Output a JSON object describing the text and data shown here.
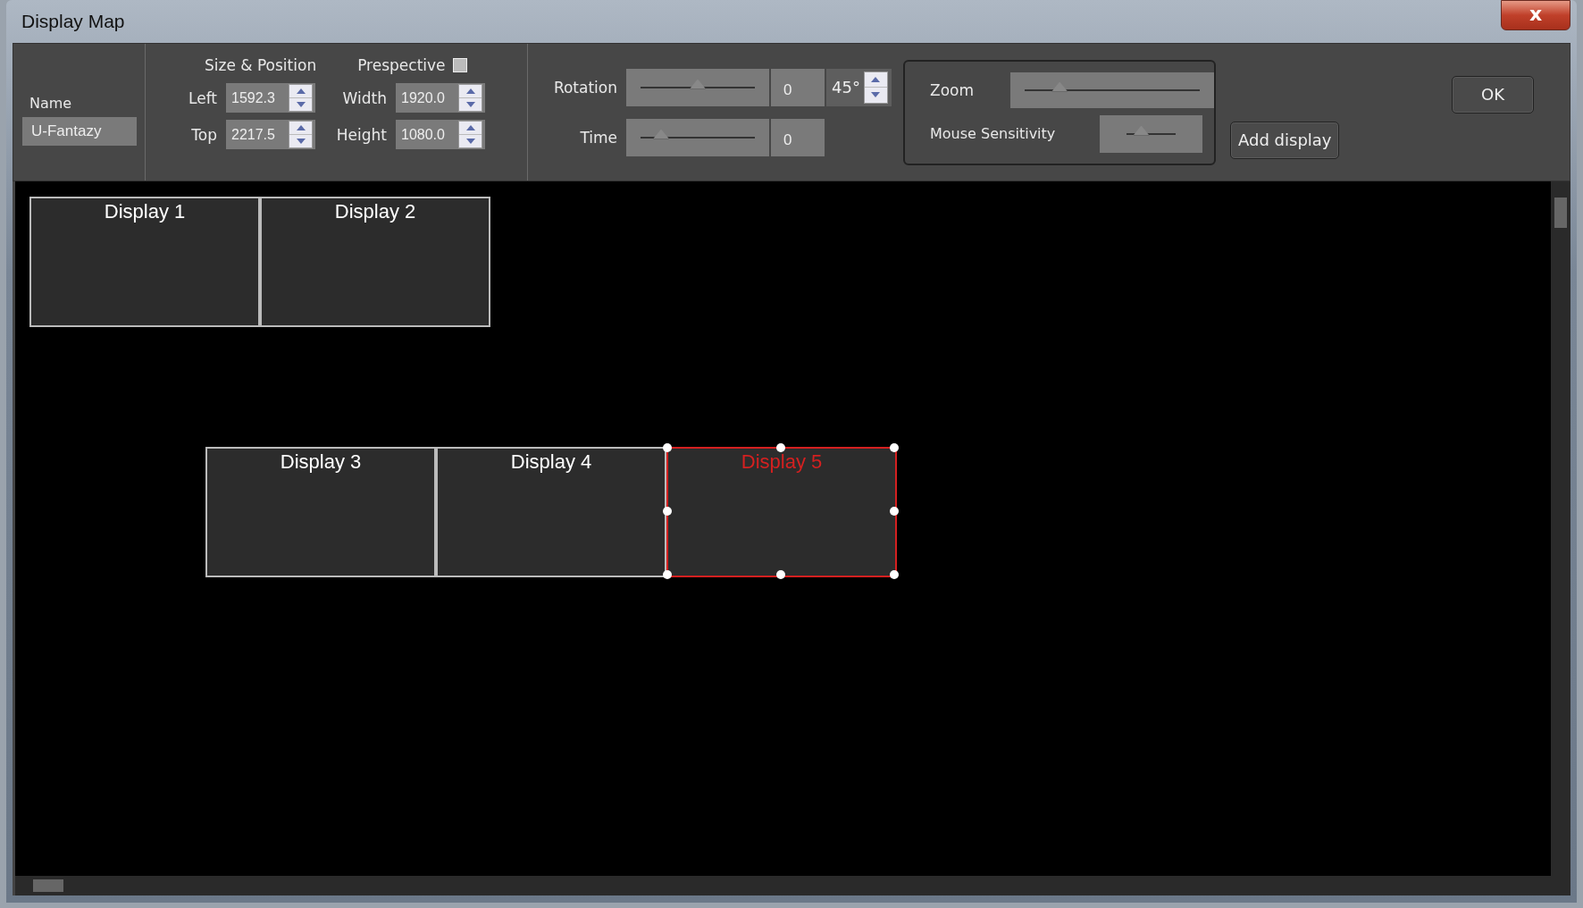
{
  "window": {
    "title": "Display Map",
    "close_label": "x"
  },
  "name_field": {
    "label": "Name",
    "value": "U-Fantazy"
  },
  "size_position": {
    "title": "Size & Position",
    "perspective_label": "Prespective",
    "perspective_checked": false,
    "fields": [
      {
        "label": "Left",
        "value": "1592.3"
      },
      {
        "label": "Width",
        "value": "1920.0"
      },
      {
        "label": "Top",
        "value": "2217.5"
      },
      {
        "label": "Height",
        "value": "1080.0"
      }
    ]
  },
  "rotation": {
    "label": "Rotation",
    "level": 0.5,
    "value": "0",
    "angle": "45°"
  },
  "time": {
    "label": "Time",
    "level": 0.18,
    "value": "0"
  },
  "zoom": {
    "label": "Zoom",
    "level": 0.2
  },
  "mouse_sensitivity": {
    "label": "Mouse Sensitivity",
    "level": 0.3
  },
  "buttons": {
    "add": "Add display",
    "ok": "OK"
  },
  "displays": [
    {
      "label": "Display 1",
      "selected": false
    },
    {
      "label": "Display 2",
      "selected": false
    },
    {
      "label": "Display 3",
      "selected": false
    },
    {
      "label": "Display 4",
      "selected": false
    },
    {
      "label": "Display 5",
      "selected": true
    }
  ]
}
